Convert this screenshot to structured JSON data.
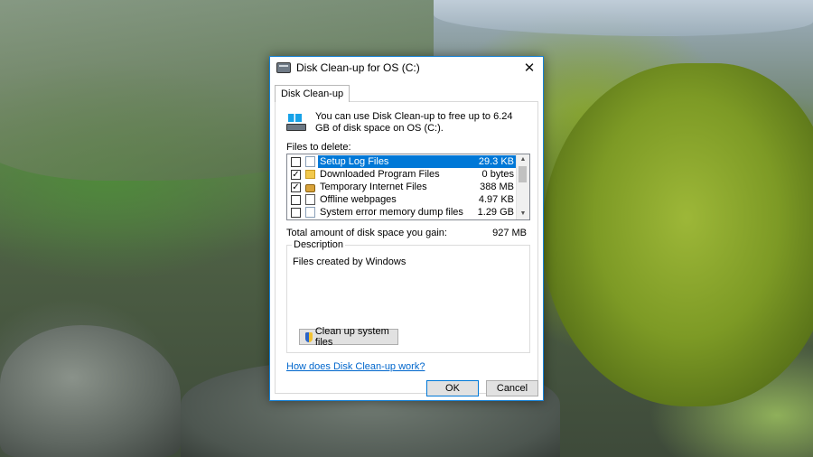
{
  "window": {
    "title": "Disk Clean-up for OS (C:)",
    "close_glyph": "✕"
  },
  "tabs": [
    {
      "label": "Disk Clean-up"
    }
  ],
  "intro": {
    "text": "You can use Disk Clean-up to free up to 6.24 GB of disk space on OS (C:).",
    "icon": "drive-icon"
  },
  "files": {
    "label": "Files to delete:",
    "items": [
      {
        "name": "Setup Log Files",
        "size": "29.3 KB",
        "checked": false,
        "selected": true,
        "icon": "doc"
      },
      {
        "name": "Downloaded Program Files",
        "size": "0 bytes",
        "checked": true,
        "selected": false,
        "icon": "folder"
      },
      {
        "name": "Temporary Internet Files",
        "size": "388 MB",
        "checked": true,
        "selected": false,
        "icon": "lock"
      },
      {
        "name": "Offline webpages",
        "size": "4.97 KB",
        "checked": false,
        "selected": false,
        "icon": "web"
      },
      {
        "name": "System error memory dump files",
        "size": "1.29 GB",
        "checked": false,
        "selected": false,
        "icon": "doc"
      }
    ]
  },
  "total": {
    "label": "Total amount of disk space you gain:",
    "value": "927 MB"
  },
  "description": {
    "legend": "Description",
    "text": "Files created by Windows"
  },
  "buttons": {
    "cleanup_system": "Clean up system files",
    "help_link": "How does Disk Clean-up work?",
    "ok": "OK",
    "cancel": "Cancel"
  }
}
